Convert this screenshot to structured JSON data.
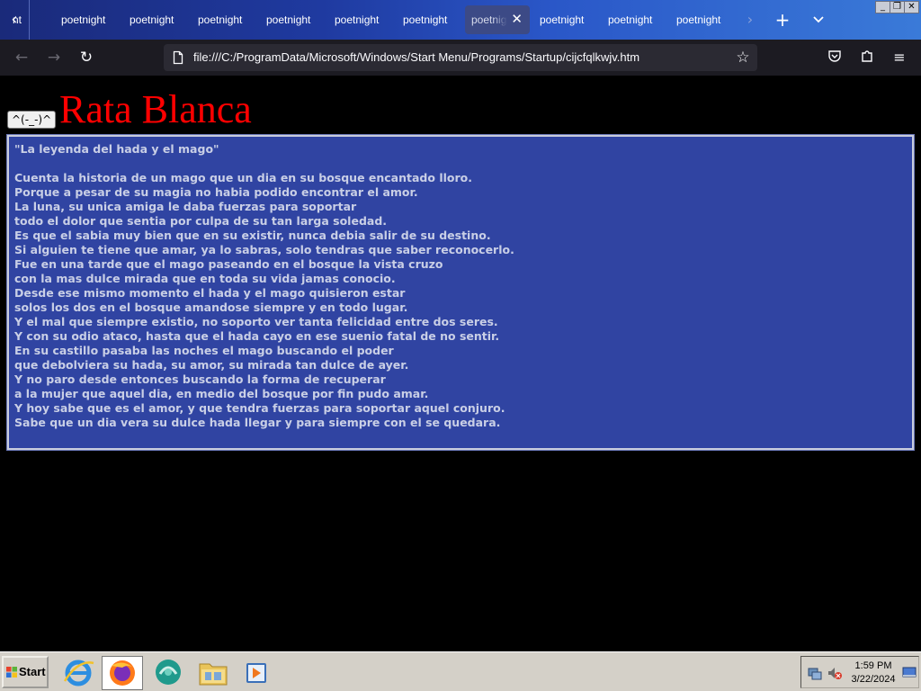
{
  "browser": {
    "tabs": [
      {
        "label": "nt"
      },
      {
        "label": "poetnight"
      },
      {
        "label": "poetnight"
      },
      {
        "label": "poetnight"
      },
      {
        "label": "poetnight"
      },
      {
        "label": "poetnight"
      },
      {
        "label": "poetnight"
      },
      {
        "label": "poetnight",
        "active": true
      },
      {
        "label": "poetnight"
      },
      {
        "label": "poetnight"
      },
      {
        "label": "poetnight"
      }
    ],
    "url": "file:///C:/ProgramData/Microsoft/Windows/Start Menu/Programs/Startup/cijcfqlkwjv.htm"
  },
  "page": {
    "button_label": "^(-_-)^",
    "heading": "Rata Blanca",
    "lyrics_title": "\"La leyenda del hada y el mago\"",
    "lyrics": [
      "Cuenta la historia de un mago que un dia en su bosque encantado lloro.",
      "Porque a pesar de su magia no habia podido encontrar el amor.",
      "La luna, su unica amiga le daba fuerzas para soportar",
      "todo el dolor que sentia por culpa de su tan larga soledad.",
      "Es que el sabia muy bien que en su existir, nunca debia salir de su destino.",
      "Si alguien te tiene que amar, ya lo sabras, solo tendras que saber reconocerlo.",
      "Fue en una tarde que el mago paseando en el bosque la vista cruzo",
      "con la mas dulce mirada que en toda su vida jamas conocio.",
      "Desde ese mismo momento el hada y el mago quisieron estar",
      "solos los dos en el bosque amandose siempre y en todo lugar.",
      "Y el mal que siempre existio, no soporto ver tanta felicidad entre dos seres.",
      "Y con su odio ataco, hasta que el hada cayo en ese suenio fatal de no sentir.",
      "En su castillo pasaba las noches el mago buscando el poder",
      "que debolviera su hada, su amor, su mirada tan dulce de ayer.",
      "Y no paro desde entonces buscando la forma de recuperar",
      "a la mujer que aquel dia, en medio del bosque por fin pudo amar.",
      "Y hoy sabe que es el amor, y que tendra fuerzas para soportar aquel conjuro.",
      "Sabe que un dia vera su dulce hada llegar y para siempre con el se quedara."
    ],
    "colors": {
      "heading": "#ff0000",
      "box_bg": "#3044a2",
      "text": "#c9cfe6"
    }
  },
  "taskbar": {
    "start_label": "Start",
    "time": "1:59 PM",
    "date": "3/22/2024",
    "apps": [
      "internet-explorer-icon",
      "firefox-icon",
      "chat-icon",
      "folder-icon",
      "media-player-icon"
    ]
  }
}
